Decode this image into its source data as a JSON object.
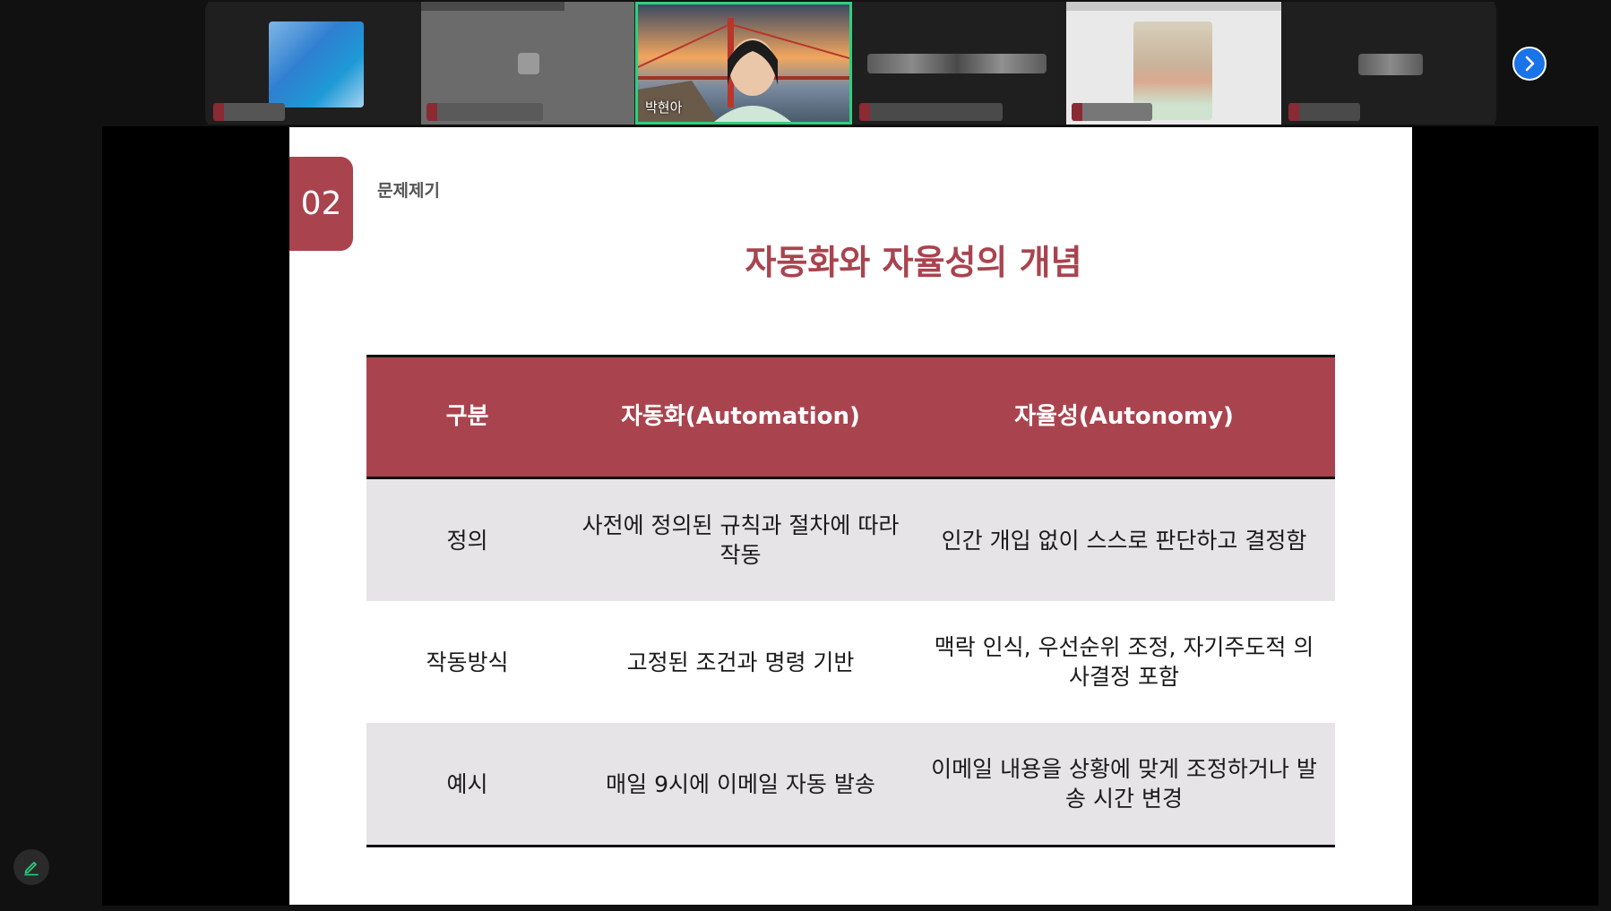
{
  "participants": [
    {
      "id": "p1",
      "name": ""
    },
    {
      "id": "p2",
      "name": ""
    },
    {
      "id": "p3",
      "name": "박현아"
    },
    {
      "id": "p4",
      "name": ""
    },
    {
      "id": "p5",
      "name": ""
    },
    {
      "id": "p6",
      "name": ""
    }
  ],
  "colors": {
    "accent": "#a9444f",
    "active_border": "#2fd07f",
    "nav_button": "#1a73e8"
  },
  "icons": {
    "next": "chevron-right-icon",
    "pen": "pen-icon"
  },
  "slide": {
    "section_number": "02",
    "section_label": "문제제기",
    "title": "자동화와 자율성의 개념",
    "table": {
      "headers": [
        "구분",
        "자동화(Automation)",
        "자율성(Autonomy)"
      ],
      "rows": [
        [
          "정의",
          "사전에 정의된 규칙과 절차에 따라 작동",
          "인간 개입 없이 스스로 판단하고 결정함"
        ],
        [
          "작동방식",
          "고정된 조건과 명령 기반",
          "맥락 인식, 우선순위 조정, 자기주도적 의사결정 포함"
        ],
        [
          "예시",
          "매일 9시에 이메일 자동 발송",
          "이메일 내용을 상황에 맞게 조정하거나 발송 시간 변경"
        ]
      ]
    }
  }
}
